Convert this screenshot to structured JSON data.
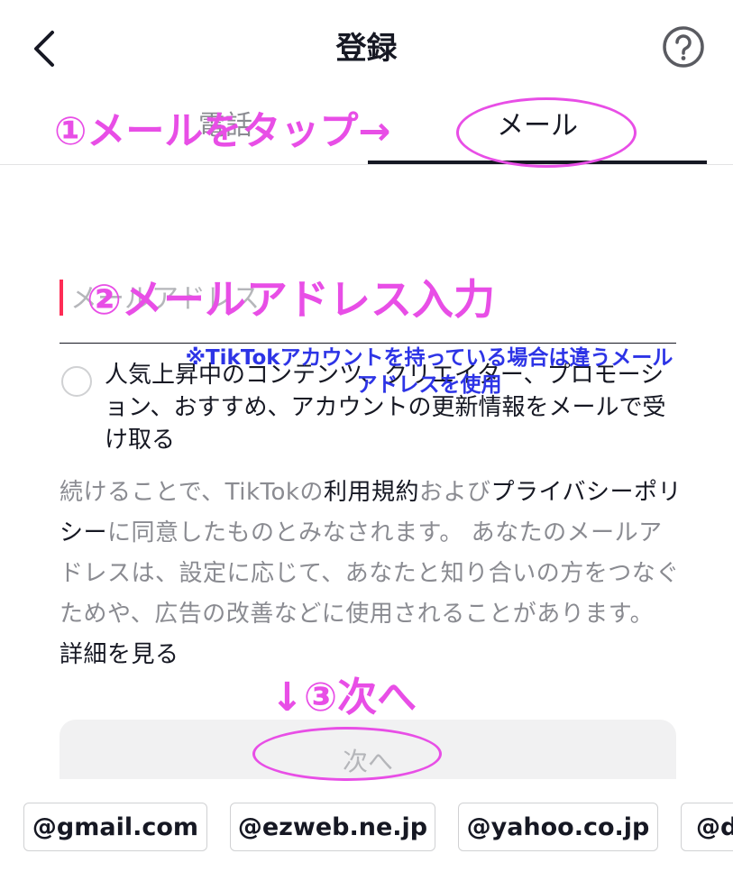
{
  "header": {
    "title": "登録",
    "back_icon": "chevron-left-icon",
    "help_icon": "question-circle-icon"
  },
  "tabs": [
    {
      "label": "電話",
      "selected": false
    },
    {
      "label": "メール",
      "selected": true
    }
  ],
  "email_input": {
    "placeholder": "メールアドレス",
    "value": ""
  },
  "consent": {
    "label": "人気上昇中のコンテンツ、クリエイター、プロモーション、おすすめ、アカウントの更新情報をメールで受け取る",
    "checked": false
  },
  "legal": {
    "part1": "続けることで、TikTokの",
    "terms_link": "利用規約",
    "part2": "および",
    "privacy_link": "プライバシーポリシー",
    "part3": "に同意したものとみなされます。 あなたのメールアドレスは、設定に応じて、あなたと知り合いの方をつなぐためや、広告の改善などに使用されることがあります。 ",
    "details_link": "詳細を見る"
  },
  "next_button": {
    "label": "次へ",
    "enabled": false
  },
  "domain_suggestions": [
    "@gmail.com",
    "@ezweb.ne.jp",
    "@yahoo.co.jp",
    "@d"
  ],
  "annotations": {
    "step1": "①メールをタップ→",
    "step2": "②メールアドレス入力",
    "note": "※TikTokアカウントを持っている場合は違うメールアドレスを使用",
    "step3": "↓③次へ"
  },
  "colors": {
    "accent": "#fe2c55",
    "annotation_pink": "#e84ee6",
    "annotation_blue": "#2d34e6"
  }
}
